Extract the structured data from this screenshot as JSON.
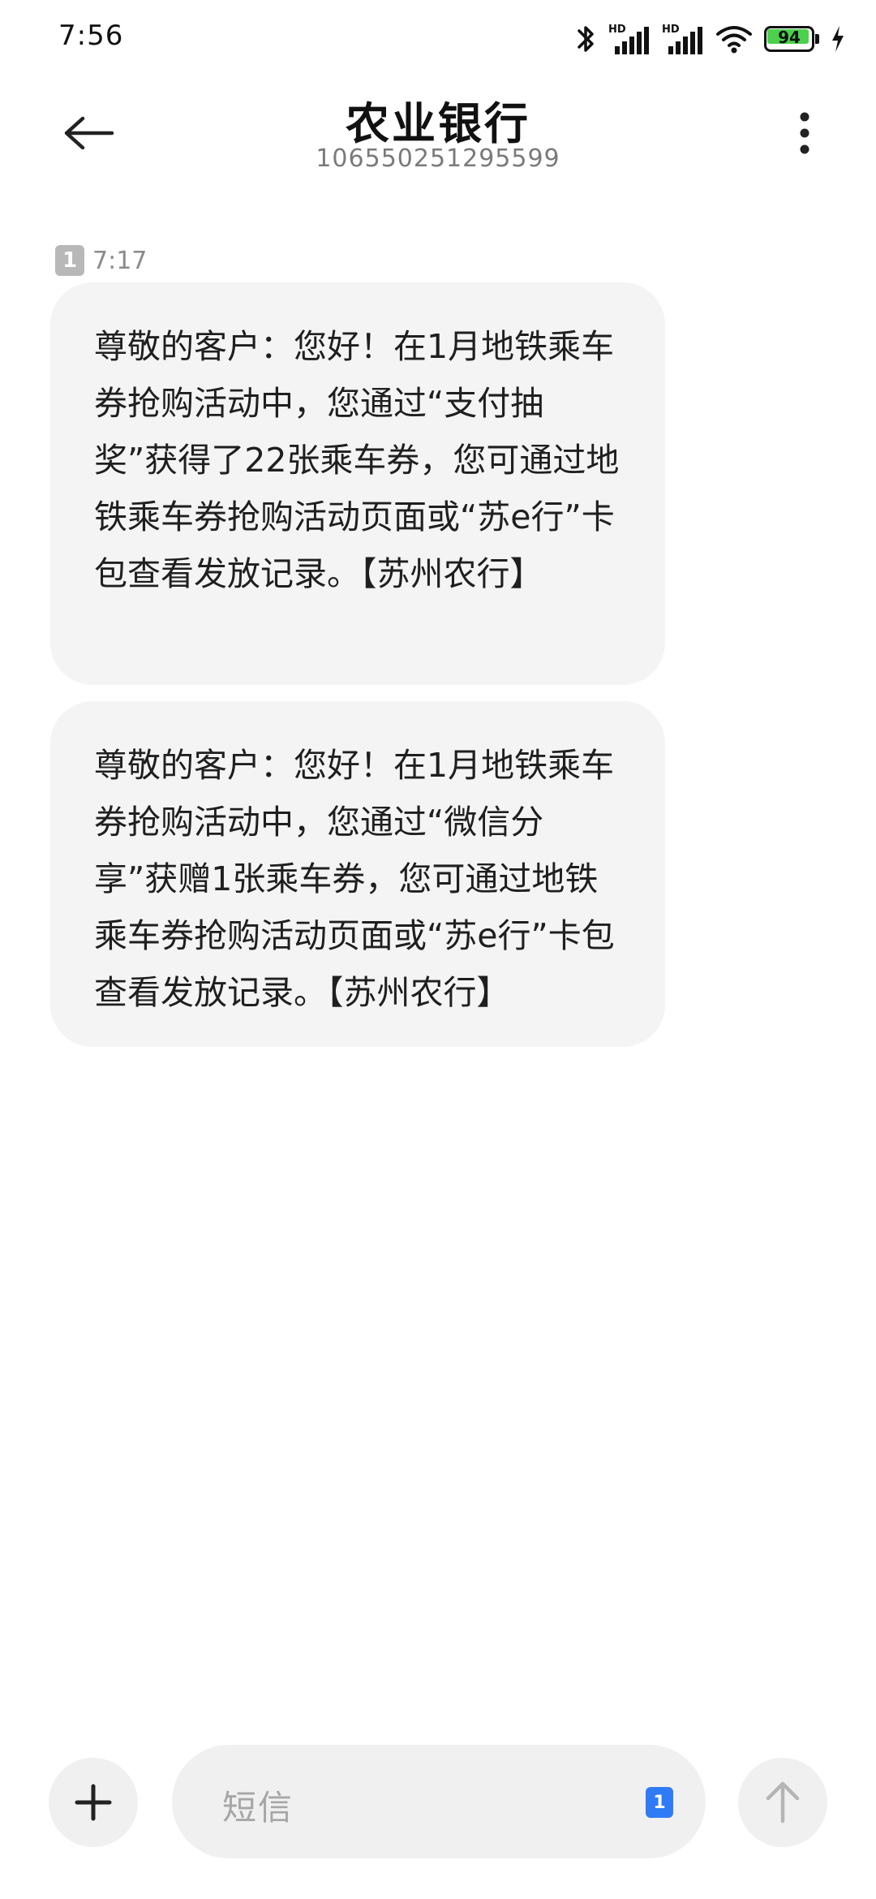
{
  "status_bar": {
    "time": "7:56",
    "battery_level": 94,
    "battery_text": "94",
    "icons": [
      "bluetooth-icon",
      "hd-signal-icon",
      "hd-signal-icon",
      "wifi-icon",
      "battery-icon",
      "charging-icon"
    ],
    "battery_color": "#4bd14b"
  },
  "header": {
    "title": "农业银行",
    "number": "106550251295599",
    "back_icon": "arrow-left-icon",
    "more_icon": "more-vertical-icon"
  },
  "conversation": {
    "sim_label": "1",
    "time": "7:17",
    "messages": [
      {
        "text": "尊敬的客户：您好！在1月地铁乘车券抢购活动中，您通过“支付抽奖”获得了22张乘车券，您可通过地铁乘车券抢购活动页面或“苏e行”卡包查看发放记录。【苏州农行】"
      },
      {
        "text": "尊敬的客户：您好！在1月地铁乘车券抢购活动中，您通过“微信分享”获赠1张乘车券，您可通过地铁乘车券抢购活动页面或“苏e行”卡包查看发放记录。【苏州农行】"
      }
    ]
  },
  "composer": {
    "placeholder": "短信",
    "sim_label": "1",
    "add_icon": "plus-icon",
    "send_icon": "arrow-up-icon",
    "accent": "#2f7bf5"
  }
}
